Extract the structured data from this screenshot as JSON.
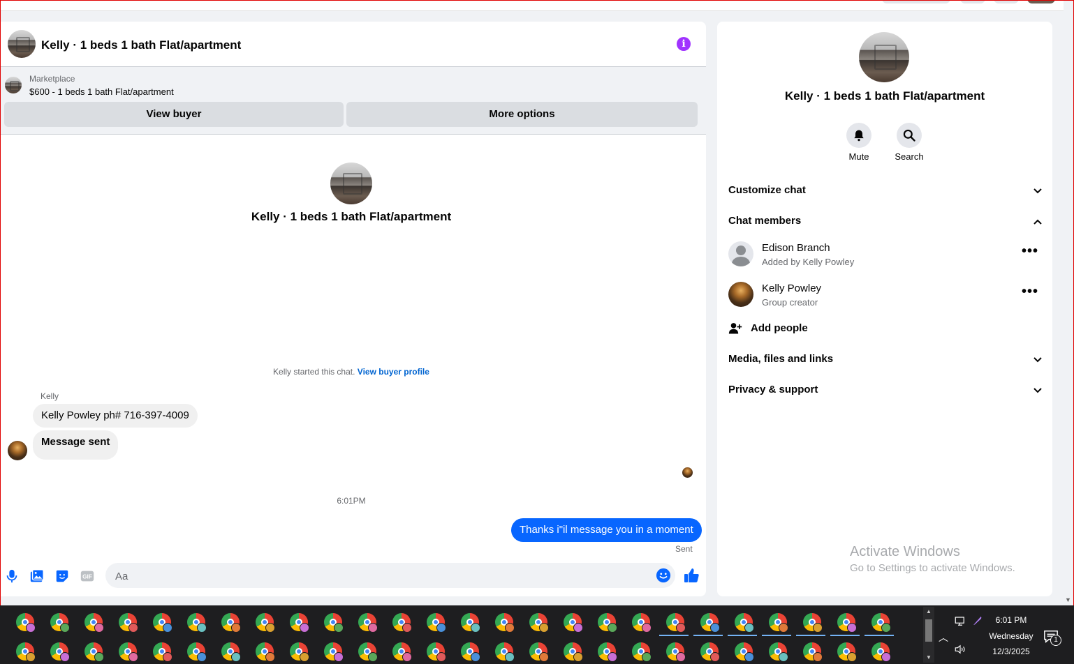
{
  "chat": {
    "header_title": "Kelly · 1 beds 1 bath Flat/apartment",
    "marketplace_label": "Marketplace",
    "listing_title": "$600 - 1 beds 1 bath Flat/apartment",
    "view_buyer_label": "View buyer",
    "more_options_label": "More options",
    "center_title": "Kelly · 1 beds 1 bath Flat/apartment",
    "started_text": "Kelly started this chat.",
    "view_buyer_profile_link": "View buyer profile",
    "sender_name": "Kelly",
    "messages_in": [
      "Kelly Powley  ph# 716-397-4009",
      "Message sent"
    ],
    "timestamp": "6:01PM",
    "message_out": "Thanks i\"il message you in a moment",
    "sent_status": "Sent",
    "composer_placeholder": "Aa",
    "accent_color": "#0866ff",
    "info_color": "#a033ff"
  },
  "side": {
    "title": "Kelly · 1 beds 1 bath Flat/apartment",
    "mute_label": "Mute",
    "search_label": "Search",
    "customize_chat": "Customize chat",
    "chat_members": "Chat members",
    "members": [
      {
        "name": "Edison Branch",
        "subtitle": "Added by Kelly Powley"
      },
      {
        "name": "Kelly Powley",
        "subtitle": "Group creator"
      }
    ],
    "add_people": "Add people",
    "media_files_links": "Media, files and links",
    "privacy_support": "Privacy & support"
  },
  "watermark": {
    "line1": "Activate Windows",
    "line2": "Go to Settings to activate Windows."
  },
  "taskbar": {
    "time": "6:01 PM",
    "day": "Wednesday",
    "date": "12/3/2025",
    "notification_count": "1",
    "icon_name": "chrome-profile-icon"
  }
}
